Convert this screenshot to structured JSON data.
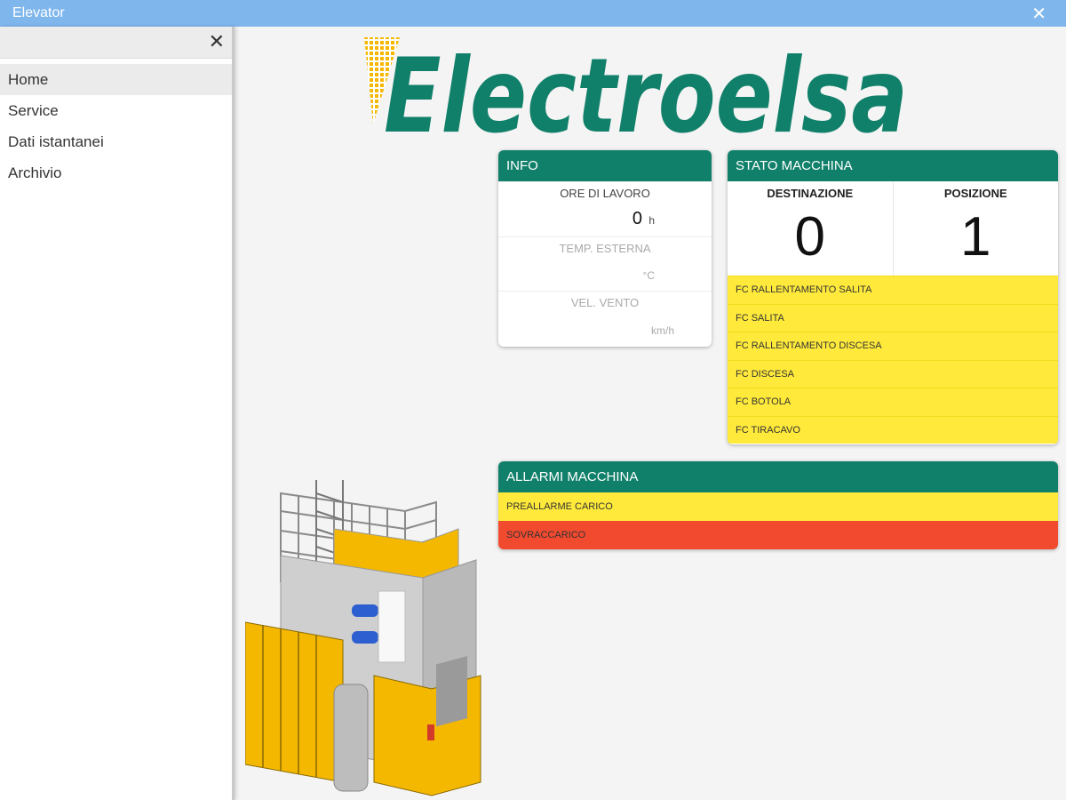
{
  "window": {
    "title": "Elevator"
  },
  "sidebar": {
    "items": [
      {
        "label": "Home",
        "active": true
      },
      {
        "label": "Service"
      },
      {
        "label": "Dati istantanei"
      },
      {
        "label": "Archivio"
      }
    ]
  },
  "logo": {
    "text": "Electroelsa"
  },
  "info": {
    "title": "INFO",
    "ore_label": "ORE DI LAVORO",
    "ore_value": "0",
    "ore_unit": "h",
    "temp_label": "TEMP. ESTERNA",
    "temp_value": "",
    "temp_unit": "°C",
    "vento_label": "VEL. VENTO",
    "vento_value": "",
    "vento_unit": "km/h"
  },
  "stato": {
    "title": "STATO MACCHINA",
    "destinazione_label": "DESTINAZIONE",
    "destinazione_value": "0",
    "posizione_label": "POSIZIONE",
    "posizione_value": "1",
    "fc": [
      "FC RALLENTAMENTO SALITA",
      "FC SALITA",
      "FC RALLENTAMENTO DISCESA",
      "FC DISCESA",
      "FC BOTOLA",
      "FC TIRACAVO"
    ]
  },
  "allarmi": {
    "title": "ALLARMI MACCHINA",
    "rows": [
      {
        "label": "PREALLARME CARICO",
        "status": "warning"
      },
      {
        "label": "SOVRACCARICO",
        "status": "error"
      }
    ]
  },
  "colors": {
    "titlebar": "#7fb6ec",
    "header_green": "#11806a",
    "warn_yellow": "#ffea3b",
    "error_red": "#f24a2f",
    "logo_yellow": "#f5b800"
  },
  "icons": [
    "close-icon",
    "sidebar-close-icon"
  ]
}
